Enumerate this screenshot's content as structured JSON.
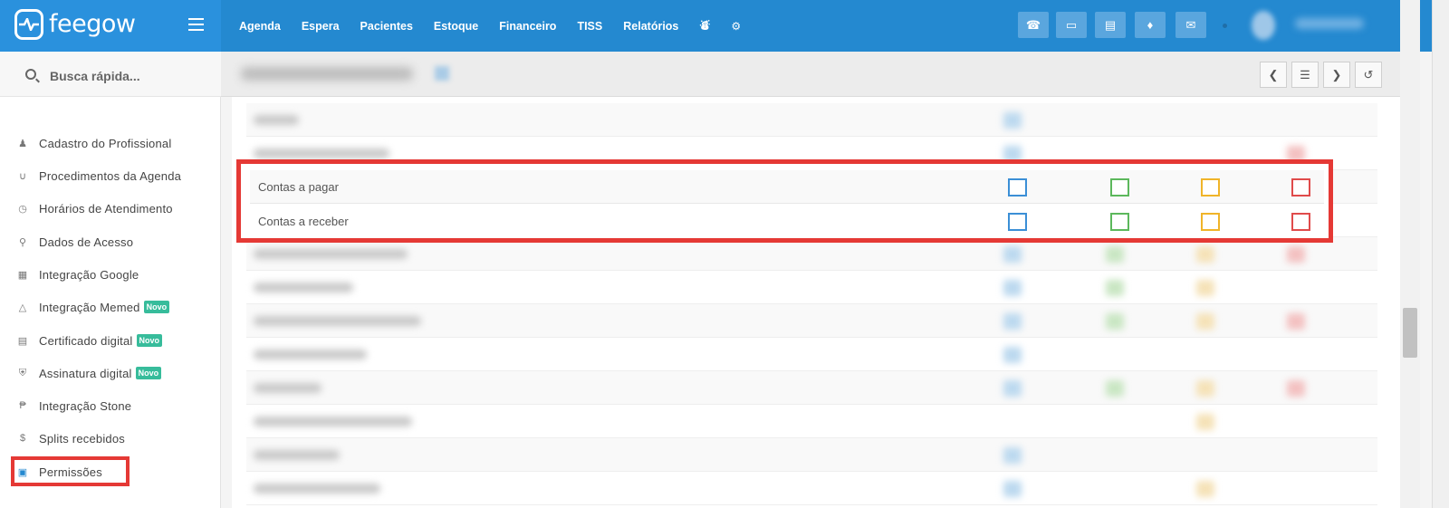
{
  "app": {
    "brand": "feegow"
  },
  "nav": {
    "items": [
      "Agenda",
      "Espera",
      "Pacientes",
      "Estoque",
      "Financeiro",
      "TISS",
      "Relatórios"
    ],
    "extra_icons": [
      "database-icon",
      "gear-icon"
    ]
  },
  "toolbar_icons": [
    "phone-icon",
    "inbox-icon",
    "card-icon",
    "bell-icon",
    "chat-icon"
  ],
  "search": {
    "placeholder": "Busca rápida..."
  },
  "sidebar": {
    "items": [
      {
        "label": "Cadastro do Profissional",
        "icon": "user-md-icon",
        "badge": ""
      },
      {
        "label": "Procedimentos da Agenda",
        "icon": "stethoscope-icon",
        "badge": ""
      },
      {
        "label": "Horários de Atendimento",
        "icon": "clock-icon",
        "badge": ""
      },
      {
        "label": "Dados de Acesso",
        "icon": "key-icon",
        "badge": ""
      },
      {
        "label": "Integração Google",
        "icon": "calendar-icon",
        "badge": ""
      },
      {
        "label": "Integração Memed",
        "icon": "flask-icon",
        "badge": "Novo"
      },
      {
        "label": "Certificado digital",
        "icon": "credit-card-icon",
        "badge": "Novo"
      },
      {
        "label": "Assinatura digital",
        "icon": "shield-icon",
        "badge": "Novo"
      },
      {
        "label": "Integração Stone",
        "icon": "stone-icon",
        "badge": ""
      },
      {
        "label": "Splits recebidos",
        "icon": "dollar-icon",
        "badge": ""
      },
      {
        "label": "Permissões",
        "icon": "lock-icon",
        "badge": ""
      }
    ]
  },
  "header_buttons": [
    "chevron-left-icon",
    "list-icon",
    "chevron-right-icon",
    "history-icon"
  ],
  "permissions": {
    "highlighted_rows": [
      {
        "label": "Contas a pagar"
      },
      {
        "label": "Contas a receber"
      }
    ]
  },
  "colors": {
    "topbar": "#2489d0",
    "highlight": "#e53935",
    "view": "#3b8fd6",
    "add": "#5cb85c",
    "edit": "#f0b429",
    "remove": "#e04b4b",
    "badge": "#37bc9b"
  }
}
